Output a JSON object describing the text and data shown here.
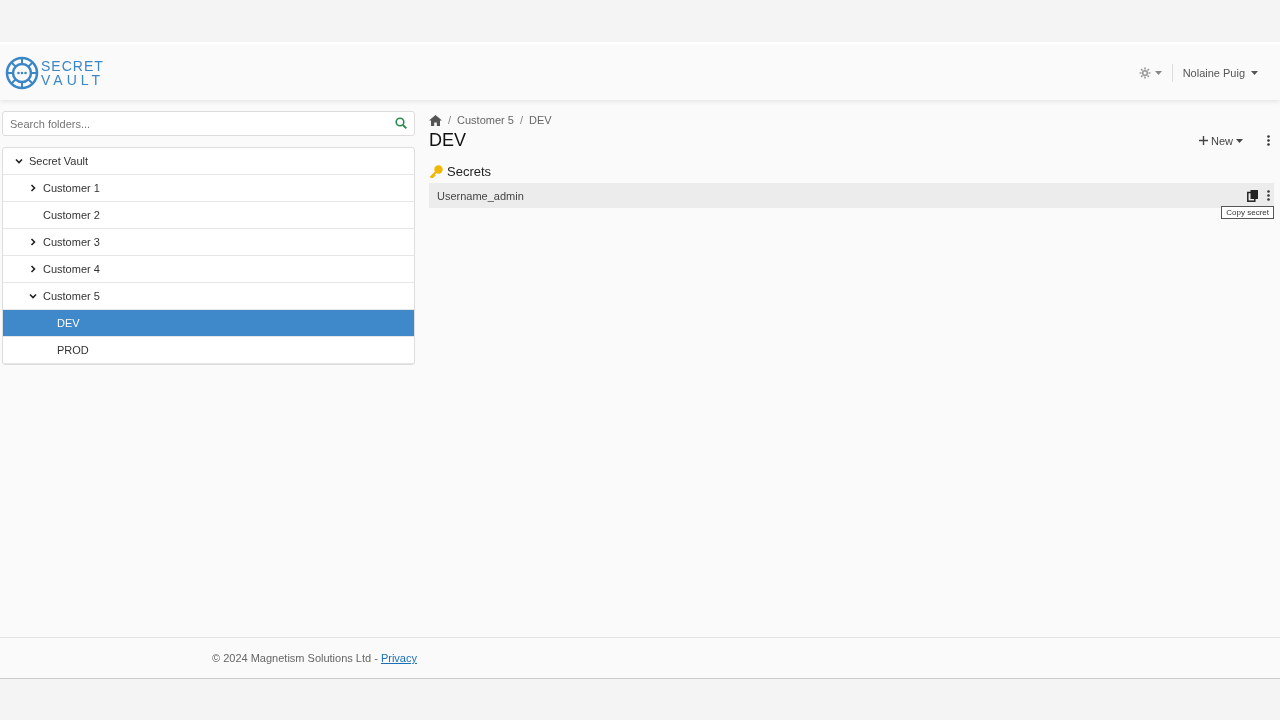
{
  "header": {
    "logo_line_1": "SECRET",
    "logo_line_2": "VAULT",
    "user": "Nolaine Puig"
  },
  "sidebar": {
    "search": {
      "placeholder": "Search folders..."
    },
    "tree": [
      {
        "label": "Secret Vault",
        "kind": "folder",
        "expanded": true,
        "selected": false,
        "children": [
          {
            "label": "Customer 1",
            "kind": "folder",
            "expanded": false,
            "selected": false
          },
          {
            "label": "Customer 2",
            "kind": "leaf",
            "selected": false
          },
          {
            "label": "Customer 3",
            "kind": "folder",
            "expanded": false,
            "selected": false
          },
          {
            "label": "Customer 4",
            "kind": "folder",
            "expanded": false,
            "selected": false
          },
          {
            "label": "Customer 5",
            "kind": "folder",
            "expanded": true,
            "selected": false,
            "children": [
              {
                "label": "DEV",
                "kind": "leaf",
                "selected": true
              },
              {
                "label": "PROD",
                "kind": "leaf",
                "selected": false
              }
            ]
          }
        ]
      }
    ]
  },
  "breadcrumb": [
    {
      "separator": "/",
      "label": "Customer 5"
    },
    {
      "separator": "/",
      "label": "DEV"
    }
  ],
  "page_title": "DEV",
  "new_button": "New",
  "section_title": "Secrets",
  "secrets": [
    {
      "name": "Username_admin"
    }
  ],
  "tooltip": "Copy secret",
  "footer": {
    "text": "© 2024 Magnetism Solutions Ltd - ",
    "link": "Privacy"
  }
}
